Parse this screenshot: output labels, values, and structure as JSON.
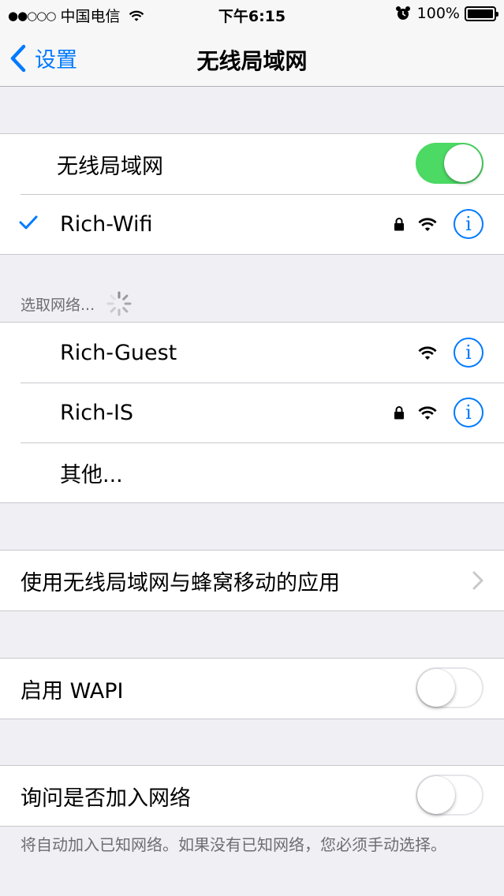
{
  "status_bar": {
    "signal": "●●○○○",
    "carrier": "中国电信",
    "time": "下午6:15",
    "battery_text": "100%",
    "battery_level": 1.0
  },
  "nav": {
    "back_label": "设置",
    "title": "无线局域网"
  },
  "wifi": {
    "toggle_label": "无线局域网",
    "enabled": true,
    "connected_network": "Rich-Wifi"
  },
  "networks_header": "选取网络...",
  "networks": [
    {
      "name": "Rich-Guest",
      "locked": false
    },
    {
      "name": "Rich-IS",
      "locked": true
    }
  ],
  "other_label": "其他...",
  "apps_row_label": "使用无线局域网与蜂窝移动的应用",
  "wapi": {
    "label": "启用 WAPI",
    "enabled": false
  },
  "ask_join": {
    "label": "询问是否加入网络",
    "enabled": false
  },
  "footer_text": "将自动加入已知网络。如果没有已知网络，您必须手动选择。",
  "icons": {
    "info": "i"
  },
  "colors": {
    "accent": "#007aff",
    "switch_on": "#4cd964",
    "background": "#efeff4"
  }
}
